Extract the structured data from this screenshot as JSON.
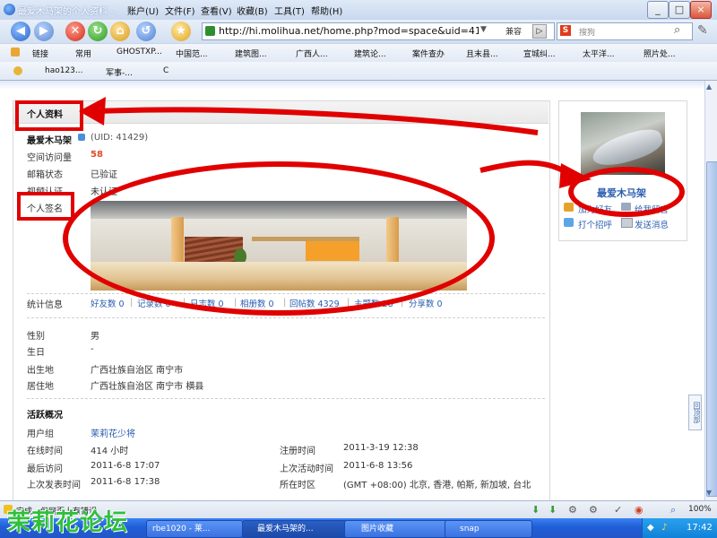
{
  "window": {
    "title": "最爱木马架的个人资料 - ...",
    "menu": [
      "账户(U)",
      "文件(F)",
      "查看(V)",
      "收藏(B)",
      "工具(T)",
      "帮助(H)"
    ],
    "controls": [
      "_",
      "□",
      "×"
    ]
  },
  "toolbar": {
    "address": "http://hi.molihua.net/home.php?mod=space&uid=41",
    "compat_label": "兼容",
    "search_placeholder": "搜狗"
  },
  "favorites": {
    "row1": [
      "链接",
      "常用",
      "GHOSTXP...",
      "中国范...",
      "建筑图...",
      "广西人...",
      "建筑论...",
      "案件查办",
      "且末县...",
      "宣城纠...",
      "太平洋...",
      "照片处..."
    ],
    "row2": [
      "hao123...",
      "军事-...",
      "C"
    ]
  },
  "profile": {
    "section_title": "个人资料",
    "username": "最爱木马架",
    "uid": "(UID: 41429)",
    "visits_label": "空间访问量",
    "visits_value": "58",
    "email_label": "邮箱状态",
    "email_value": "已验证",
    "video_label": "视频认证",
    "video_value": "未认证",
    "signature_label": "个人签名",
    "stats_label": "统计信息",
    "stats": [
      {
        "label": "好友数",
        "value": "0"
      },
      {
        "label": "记录数",
        "value": "0"
      },
      {
        "label": "日志数",
        "value": "0"
      },
      {
        "label": "相册数",
        "value": "0"
      },
      {
        "label": "回帖数",
        "value": "4329"
      },
      {
        "label": "主题数",
        "value": "28"
      },
      {
        "label": "分享数",
        "value": "0"
      }
    ],
    "gender_label": "性别",
    "gender_value": "男",
    "birthday_label": "生日",
    "birthday_value": "-",
    "birthplace_label": "出生地",
    "birthplace_value": "广西壮族自治区 南宁市",
    "residence_label": "居住地",
    "residence_value": "广西壮族自治区 南宁市 横县",
    "activity_title": "活跃概况",
    "group_label": "用户组",
    "group_value": "茉莉花少将",
    "online_label": "在线时间",
    "online_value": "414 小时",
    "register_label": "注册时间",
    "register_value": "2011-3-19 12:38",
    "lastvisit_label": "最后访问",
    "lastvisit_value": "2011-6-8 17:07",
    "lastactive_label": "上次活动时间",
    "lastactive_value": "2011-6-8 13:56",
    "lastpost_label": "上次发表时间",
    "lastpost_value": "2011-6-8 17:38",
    "timezone_label": "所在时区",
    "timezone_value": "(GMT +08:00) 北京, 香港, 帕斯, 新加坡, 台北"
  },
  "sidebar": {
    "name": "最爱木马架",
    "add_friend": "加为好友",
    "leave_msg": "给我留言",
    "greet": "打个招呼",
    "send_msg": "发送消息",
    "back_top": "回顶部"
  },
  "statusbar": {
    "text": "完成，但网页上有错误",
    "zoom": "100%"
  },
  "taskbar": {
    "tasks": [
      "rbe1020 - 莱...",
      "最爱木马架的...",
      "图片收藏",
      "snap"
    ],
    "clock": "17:42"
  },
  "watermark": "茉莉花论坛"
}
